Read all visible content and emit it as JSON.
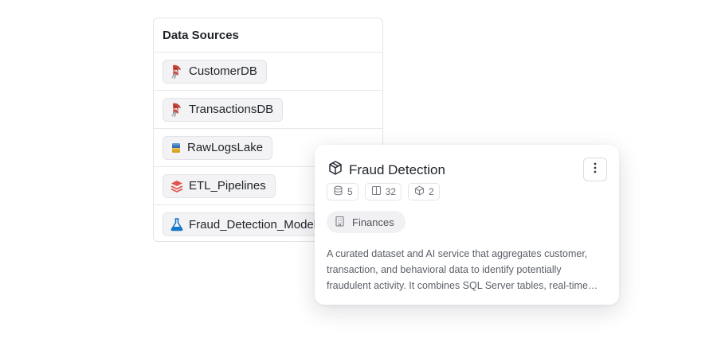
{
  "data_sources": {
    "title": "Data Sources",
    "items": [
      {
        "label": "CustomerDB",
        "icon": "sql-server-icon"
      },
      {
        "label": "TransactionsDB",
        "icon": "sql-server-icon"
      },
      {
        "label": "RawLogsLake",
        "icon": "data-lake-icon"
      },
      {
        "label": "ETL_Pipelines",
        "icon": "layers-icon"
      },
      {
        "label": "Fraud_Detection_Model",
        "icon": "ml-flask-icon"
      }
    ]
  },
  "card": {
    "title": "Fraud Detection",
    "icon": "cube-icon",
    "stats": {
      "databases": "5",
      "columns": "32",
      "models": "2"
    },
    "tag": "Finances",
    "description": "A curated dataset and AI service that aggregates customer, transaction, and behavioral data to identify potentially fraudulent activity. It combines SQL Server tables, real-time streaming logs, and machine learning models to flag suspicious transactions."
  },
  "colors": {
    "sql_red": "#c8433a",
    "lake_blue": "#2f6fb5",
    "lake_gold": "#d9a521",
    "layers_red": "#e0554a",
    "flask_blue": "#1677c9"
  }
}
